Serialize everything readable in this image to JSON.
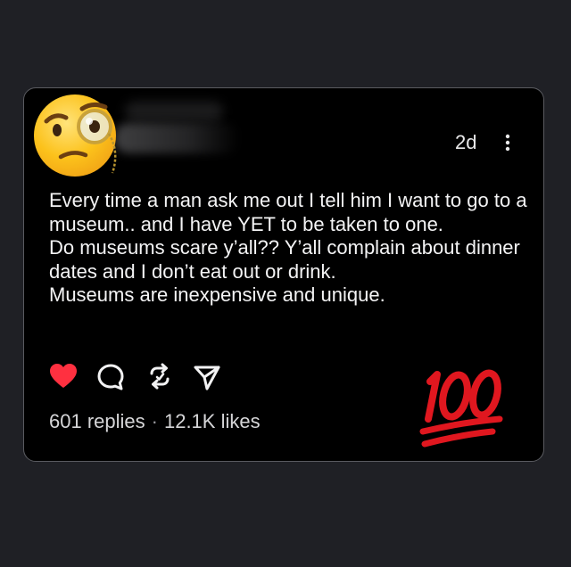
{
  "post": {
    "time": "2d",
    "text_lines": [
      "Every time a man ask me out I tell him I want to go to a museum.. and I have YET to be taken to one.",
      "Do museums scare y’all?? Y’all complain about dinner dates and I don’t eat out or drink.",
      "Museums are inexpensive and unique."
    ],
    "replies": "601 replies",
    "separator": "·",
    "likes": "12.1K likes"
  },
  "overlays": {
    "avatar_emoji": "face-with-monocle-icon",
    "reaction_emoji": "hundred-points-icon"
  },
  "colors": {
    "background": "#1f2025",
    "card": "#000000",
    "card_border": "#5a5b60",
    "text": "#f4f4f5",
    "like_active": "#ff3040",
    "hundred_red": "#e0171f"
  }
}
